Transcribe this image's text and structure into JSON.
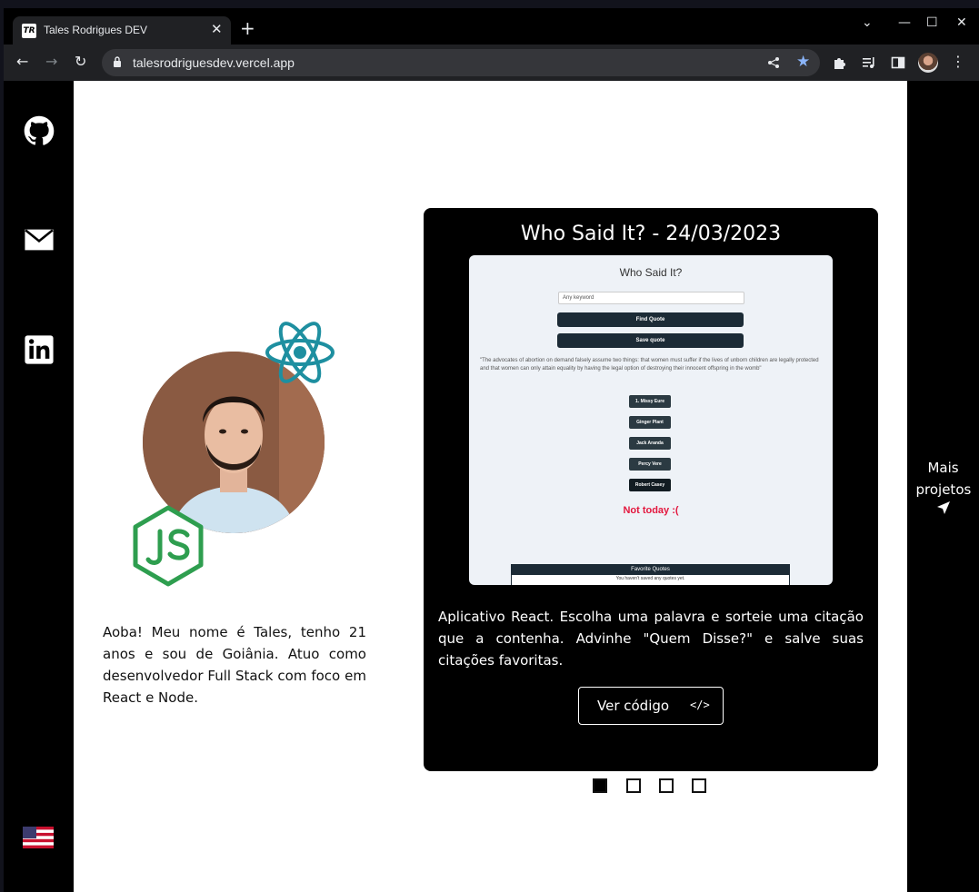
{
  "browser": {
    "tab_title": "Tales Rodrigues DEV",
    "favicon_text": "TR",
    "url": "talesrodriguesdev.vercel.app",
    "new_tab_glyph": "+",
    "tab_close_glyph": "✕"
  },
  "sidebar": {
    "links": [
      {
        "icon": "github-icon"
      },
      {
        "icon": "mail-icon"
      },
      {
        "icon": "linkedin-icon"
      }
    ],
    "language_flag": "us-flag-icon"
  },
  "profile": {
    "bio": "Aoba! Meu nome é Tales, tenho 21 anos e sou de Goiânia. Atuo como desenvolvedor Full Stack com foco em React e Node."
  },
  "project": {
    "title": "Who Said It? - 24/03/2023",
    "description": "Aplicativo React. Escolha uma palavra e sorteie uma citação que a contenha. Advinhe \"Quem Disse?\" e salve suas citações favoritas.",
    "code_button_label": "Ver código",
    "code_button_icon": "</>",
    "preview": {
      "title": "Who Said It?",
      "select_value": "Any keyword",
      "buttons": [
        "Find Quote",
        "Save quote"
      ],
      "quote": "\"The advocates of abortion on demand falsely assume two things: that women must suffer if the lives of unborn children are legally protected and that women can only attain equality by having the legal option of destroying their innocent offspring in the womb\"",
      "answers": [
        "1. Missy Eure",
        "Ginger Plant",
        "Jack Aranda",
        "Percy Vere",
        "Robert Casey"
      ],
      "result": "Not today :(",
      "favorites_title": "Favorite Quotes",
      "favorites_empty": "You haven't saved any quotes yet."
    }
  },
  "carousel": {
    "count": 4,
    "active_index": 0
  },
  "more_projects": {
    "label": "Mais projetos"
  },
  "colors": {
    "react": "#1e8fa0",
    "node": "#2e9e4f",
    "star": "#8ab4f8"
  }
}
